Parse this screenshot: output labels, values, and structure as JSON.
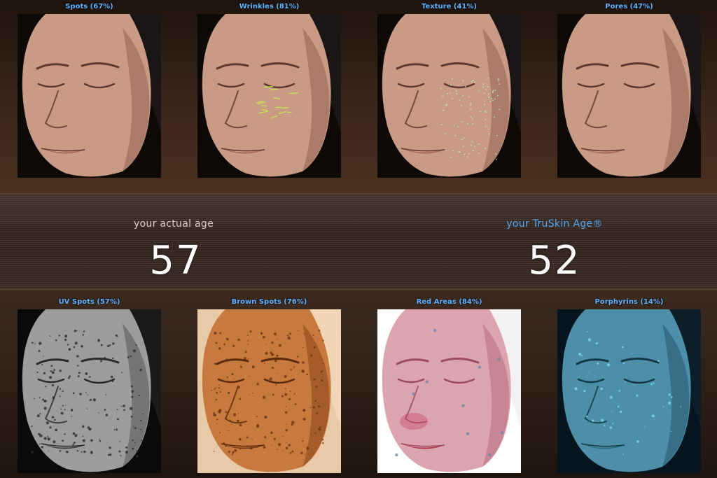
{
  "top_panels": [
    {
      "label": "Spots (67%)",
      "style": "natural"
    },
    {
      "label": "Wrinkles (81%)",
      "style": "wrinkles"
    },
    {
      "label": "Texture (41%)",
      "style": "texture"
    },
    {
      "label": "Pores (47%)",
      "style": "natural"
    }
  ],
  "bottom_panels": [
    {
      "label": "UV Spots (57%)",
      "style": "uv"
    },
    {
      "label": "Brown Spots (76%)",
      "style": "brown"
    },
    {
      "label": "Red Areas (84%)",
      "style": "red"
    },
    {
      "label": "Porphyrins (14%)",
      "style": "porphyrins"
    }
  ],
  "actual_age": {
    "label": "your actual age",
    "value": "57"
  },
  "truskin_age": {
    "label": "your TruSkin Age®",
    "value": "52"
  },
  "colors": {
    "label_blue": "#5fb2ff",
    "actual_age_label": "#d9cfc6",
    "truskin_label": "#4fa8f5",
    "age_value": "#ffffff"
  }
}
